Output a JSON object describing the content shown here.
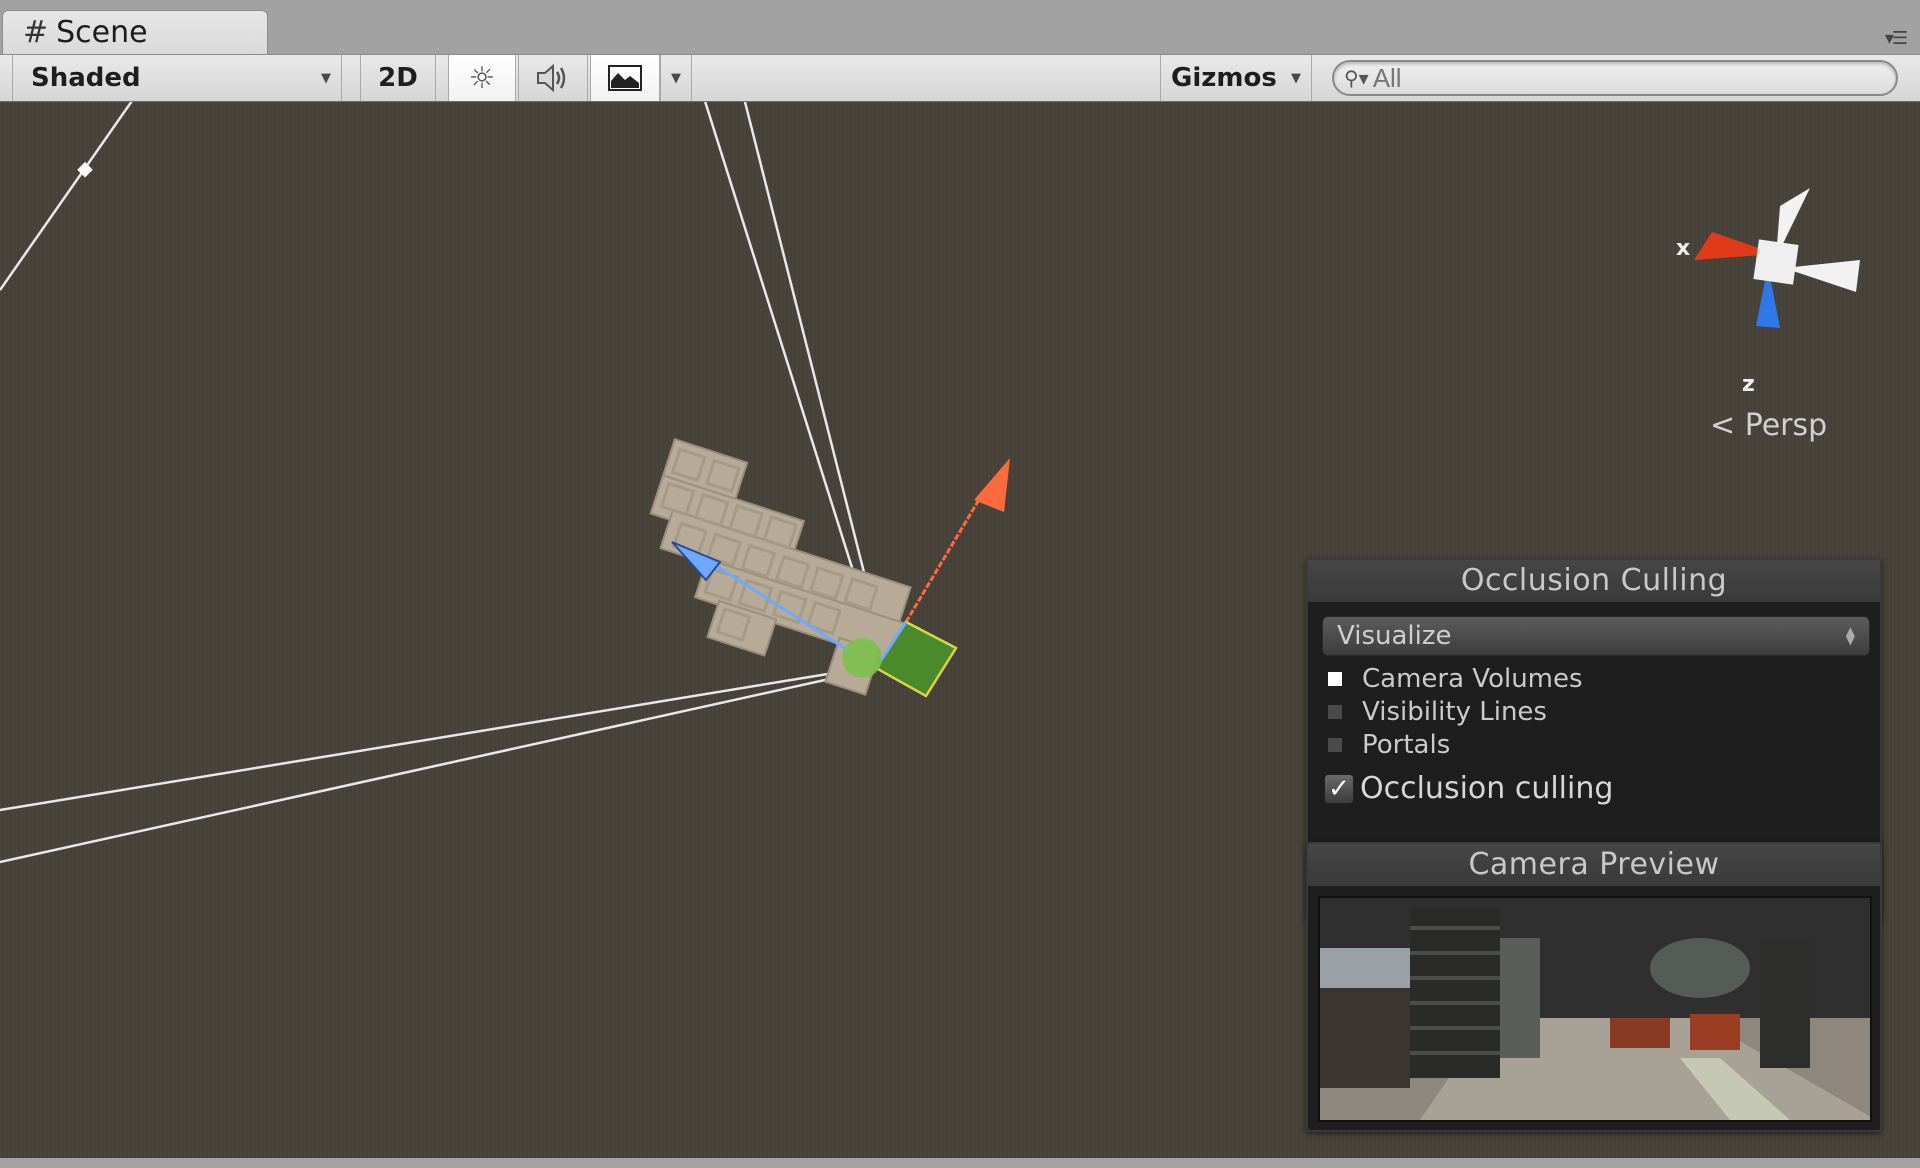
{
  "window": {
    "tab_label": "Scene",
    "tab_icon": "grid-icon",
    "tab_menu_icon": "tab-menu-icon"
  },
  "toolbar": {
    "draw_mode": "Shaded",
    "mode_2d": "2D",
    "lighting_icon": "sun-icon",
    "audio_icon": "speaker-icon",
    "effects_icon": "image-icon",
    "gizmos_label": "Gizmos",
    "search": {
      "value": "",
      "placeholder": "All"
    }
  },
  "orientation_gizmo": {
    "x_label": "x",
    "z_label": "z",
    "projection": "Persp",
    "colors": {
      "x": "#e03a17",
      "y": "#f2f2f2",
      "z": "#2f78ea"
    }
  },
  "occlusion_panel": {
    "title": "Occlusion Culling",
    "mode_select": "Visualize",
    "legend": [
      {
        "label": "Camera Volumes",
        "color": "#ffffff"
      },
      {
        "label": "Visibility Lines",
        "color": "#4a4a4a"
      },
      {
        "label": "Portals",
        "color": "#4a4a4a"
      }
    ],
    "checkbox": {
      "label": "Occlusion culling",
      "checked": true,
      "mark": "✓"
    }
  },
  "camera_preview": {
    "title": "Camera Preview"
  },
  "scene": {
    "handle_colors": {
      "forward": "#6fa8ff",
      "up": "#ff6a3c",
      "volume": "#4a8a2a"
    },
    "geometry_color": "#b7ab98"
  }
}
